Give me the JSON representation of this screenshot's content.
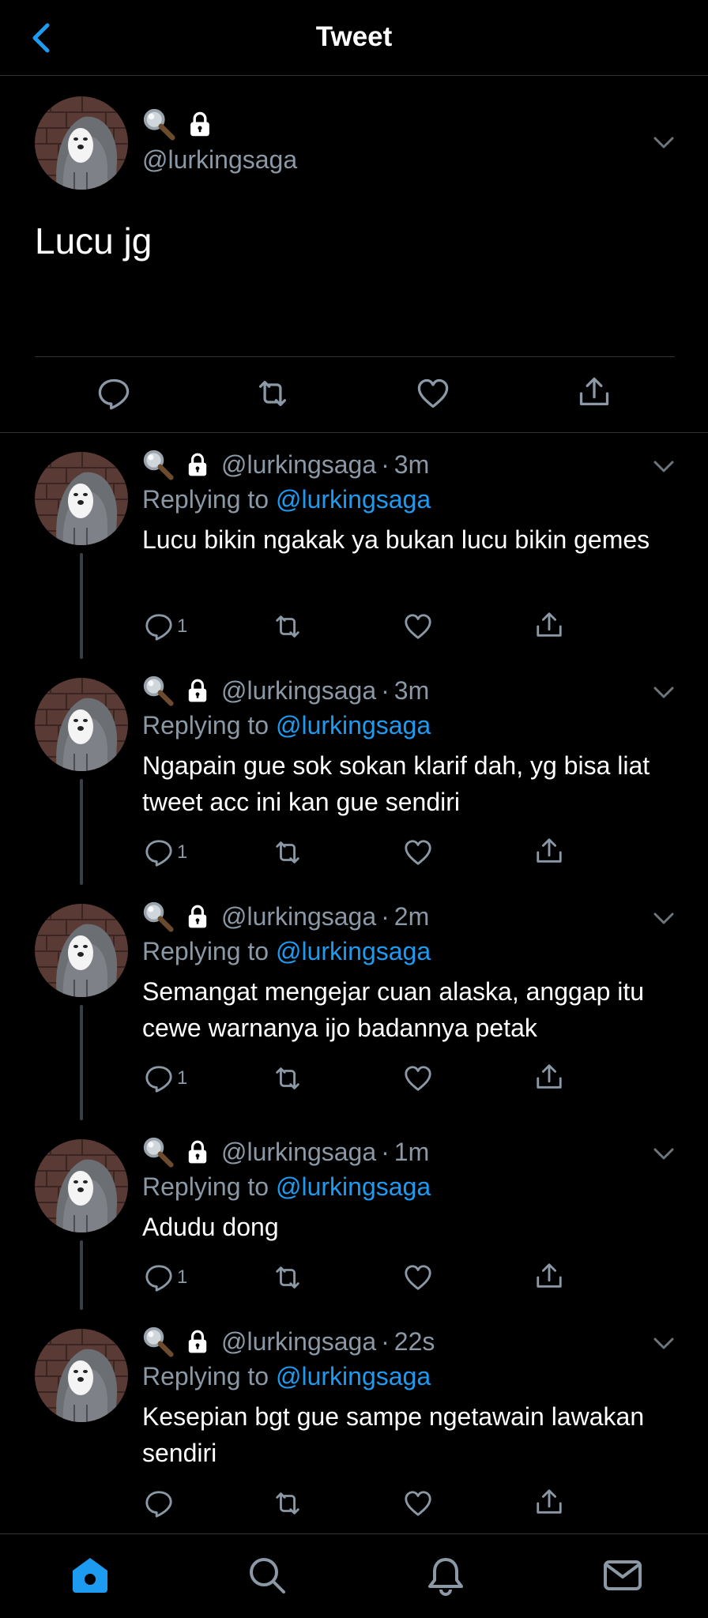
{
  "header": {
    "title": "Tweet"
  },
  "main_tweet": {
    "handle": "@lurkingsaga",
    "text": "Lucu jg"
  },
  "replies": [
    {
      "handle": "@lurkingsaga",
      "sep": "·",
      "time": "3m",
      "replying_prefix": "Replying to",
      "mention": "@lurkingsaga",
      "text": "Lucu bikin ngakak ya bukan lucu bikin gemes",
      "reply_count": "1"
    },
    {
      "handle": "@lurkingsaga",
      "sep": "·",
      "time": "3m",
      "replying_prefix": "Replying to",
      "mention": "@lurkingsaga",
      "text": "Ngapain gue sok sokan klarif dah, yg bisa liat tweet acc ini kan gue sendiri",
      "reply_count": "1"
    },
    {
      "handle": "@lurkingsaga",
      "sep": "·",
      "time": "2m",
      "replying_prefix": "Replying to",
      "mention": "@lurkingsaga",
      "text": "Semangat mengejar cuan alaska, anggap itu cewe warnanya ijo badannya petak",
      "reply_count": "1"
    },
    {
      "handle": "@lurkingsaga",
      "sep": "·",
      "time": "1m",
      "replying_prefix": "Replying to",
      "mention": "@lurkingsaga",
      "text": "Adudu dong",
      "reply_count": "1"
    },
    {
      "handle": "@lurkingsaga",
      "sep": "·",
      "time": "22s",
      "replying_prefix": "Replying to",
      "mention": "@lurkingsaga",
      "text": "Kesepian bgt gue sampe ngetawain lawakan sendiri",
      "reply_count": ""
    }
  ],
  "icons": {
    "name_emoji": [
      "magnifying-glass-icon",
      "lock-icon"
    ],
    "tab_bar": [
      "home-icon",
      "search-icon",
      "notifications-icon",
      "messages-icon"
    ]
  },
  "colors": {
    "accent": "#1d9bf0",
    "background": "#000000",
    "muted": "#8b98a5"
  }
}
